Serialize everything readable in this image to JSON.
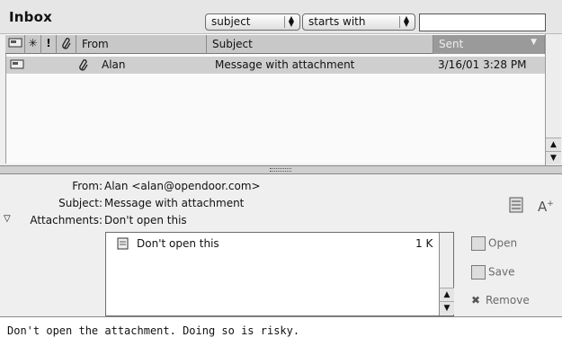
{
  "header": {
    "title": "Inbox",
    "field_select": "subject",
    "operator_select": "starts with",
    "search_value": ""
  },
  "columns": {
    "from": "From",
    "subject": "Subject",
    "sent": "Sent",
    "priority_glyph": "!",
    "attachment_glyph": "⑂"
  },
  "messages": [
    {
      "from": "Alan",
      "subject": "Message with attachment",
      "sent": "3/16/01 3:28 PM",
      "has_attachment": true
    }
  ],
  "preview": {
    "from_label": "From:",
    "from_value": "Alan <alan@opendoor.com>",
    "subject_label": "Subject:",
    "subject_value": "Message with attachment",
    "attachments_label": "Attachments:",
    "attachments_value": "Don't open this",
    "attachment_list": [
      {
        "name": "Don't open this",
        "size": "1 K"
      }
    ],
    "actions": {
      "open": "Open",
      "save": "Save",
      "remove": "Remove"
    },
    "body": "Don't open the attachment.  Doing so is risky."
  }
}
